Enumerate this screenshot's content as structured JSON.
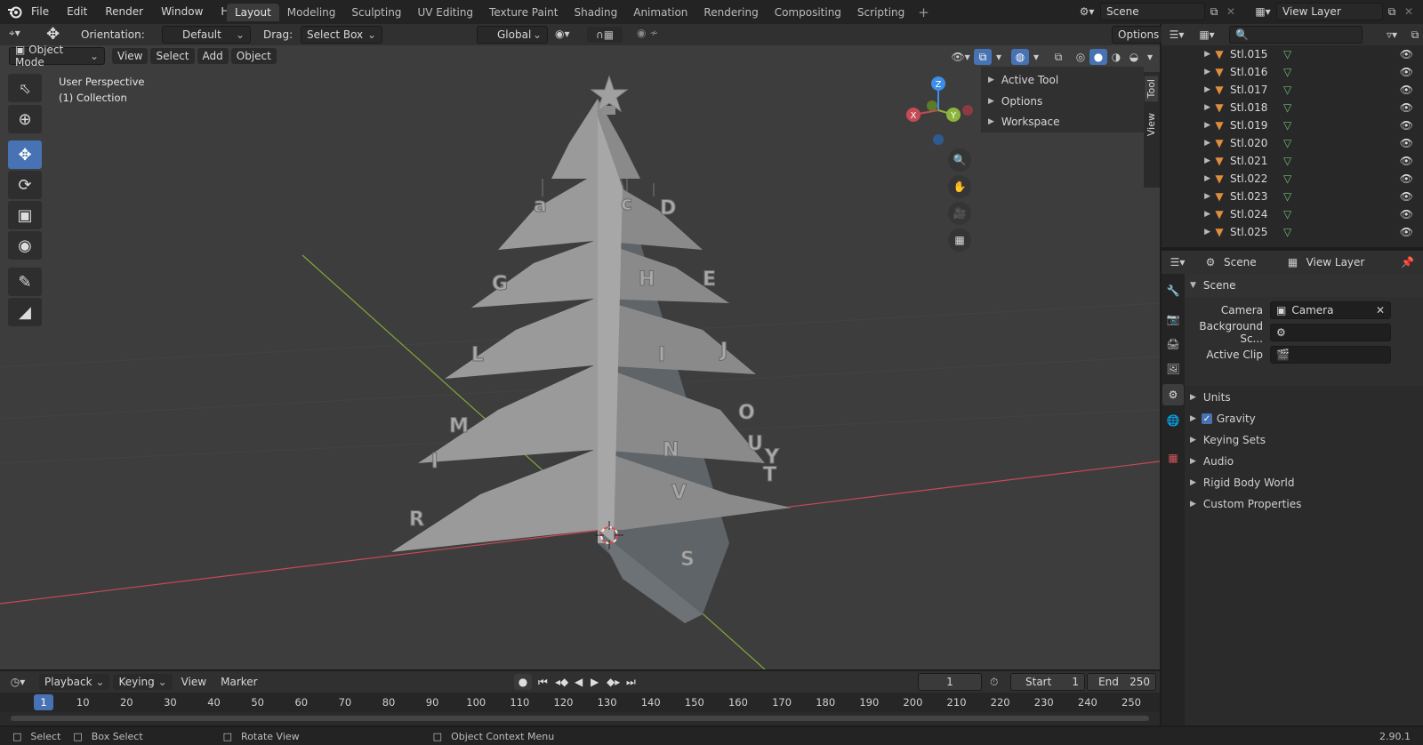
{
  "menu": {
    "file": "File",
    "edit": "Edit",
    "render": "Render",
    "window": "Window",
    "help": "Help"
  },
  "workspace_tabs": [
    "Layout",
    "Modeling",
    "Sculpting",
    "UV Editing",
    "Texture Paint",
    "Shading",
    "Animation",
    "Rendering",
    "Compositing",
    "Scripting"
  ],
  "active_tab": "Layout",
  "scene_name": "Scene",
  "view_layer_name": "View Layer",
  "header": {
    "orientation_label": "Orientation:",
    "orientation_value": "Default",
    "drag_label": "Drag:",
    "drag_value": "Select Box",
    "transform_value": "Global",
    "options": "Options"
  },
  "viewport_header": {
    "mode": "Object Mode",
    "view": "View",
    "select": "Select",
    "add": "Add",
    "object": "Object"
  },
  "viewport": {
    "perspective": "User Perspective",
    "collection": "(1) Collection"
  },
  "sidebar_panel": {
    "items": [
      "Active Tool",
      "Options",
      "Workspace"
    ],
    "tabs": [
      "Tool",
      "View"
    ]
  },
  "gizmo": {
    "x": "X",
    "y": "Y",
    "z": "Z"
  },
  "outliner": {
    "items": [
      "Stl.015",
      "Stl.016",
      "Stl.017",
      "Stl.018",
      "Stl.019",
      "Stl.020",
      "Stl.021",
      "Stl.022",
      "Stl.023",
      "Stl.024",
      "Stl.025"
    ]
  },
  "properties": {
    "breadcrumb_scene": "Scene",
    "breadcrumb_layer": "View Layer",
    "panel_title": "Scene",
    "camera_label": "Camera",
    "camera_value": "Camera",
    "background_label": "Background Sc...",
    "clip_label": "Active Clip",
    "sections": [
      "Units",
      "Gravity",
      "Keying Sets",
      "Audio",
      "Rigid Body World",
      "Custom Properties"
    ],
    "gravity_checked": true
  },
  "timeline": {
    "playback": "Playback",
    "keying": "Keying",
    "view": "View",
    "marker": "Marker",
    "current_frame": "1",
    "start_label": "Start",
    "start_value": "1",
    "end_label": "End",
    "end_value": "250",
    "ticks": [
      "1",
      "10",
      "20",
      "30",
      "40",
      "50",
      "60",
      "70",
      "80",
      "90",
      "100",
      "110",
      "120",
      "130",
      "140",
      "150",
      "160",
      "170",
      "180",
      "190",
      "200",
      "210",
      "220",
      "230",
      "240",
      "250"
    ]
  },
  "statusbar": {
    "select": "Select",
    "box_select": "Box Select",
    "rotate": "Rotate View",
    "context": "Object Context Menu",
    "version": "2.90.1"
  },
  "colors": {
    "accent": "#4772b3",
    "viewport_bg": "#3d3d3d",
    "x_axis": "#c64a55",
    "y_axis": "#8cb53e",
    "z_axis": "#3d8ee8",
    "tree": "#9a9a9a"
  }
}
